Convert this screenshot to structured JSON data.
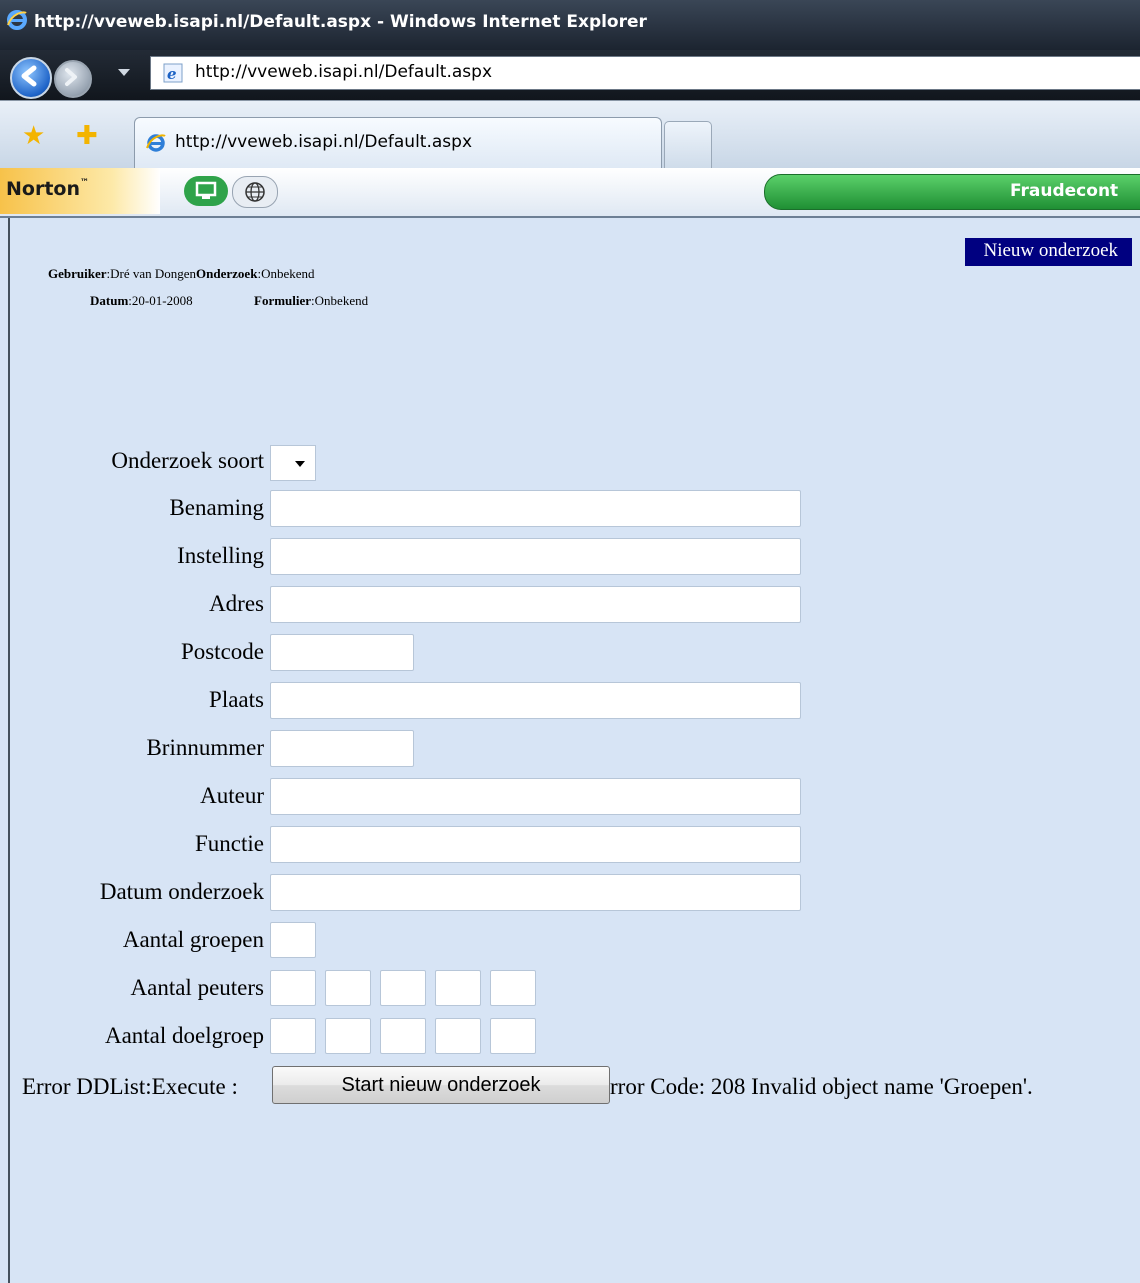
{
  "window": {
    "title": "http://vveweb.isapi.nl/Default.aspx - Windows Internet Explorer"
  },
  "address": {
    "url": "http://vveweb.isapi.nl/Default.aspx"
  },
  "tab": {
    "label": "http://vveweb.isapi.nl/Default.aspx"
  },
  "norton": {
    "brand": "Norton",
    "tm": "™",
    "fraud_label": "Fraudecont"
  },
  "page": {
    "new_investigation_label": "Nieuw onderzoek",
    "info": {
      "user_label": "Gebruiker",
      "user_value": "Dré van Dongen",
      "inv_label": "Onderzoek",
      "inv_value": "Onbekend",
      "date_label": "Datum",
      "date_value": "20-01-2008",
      "form_label": "Formulier",
      "form_value": "Onbekend"
    },
    "fields": {
      "onderzoek_soort": "Onderzoek soort",
      "benaming": "Benaming",
      "instelling": "Instelling",
      "adres": "Adres",
      "postcode": "Postcode",
      "plaats": "Plaats",
      "brinnummer": "Brinnummer",
      "auteur": "Auteur",
      "functie": "Functie",
      "datum_onderzoek": "Datum onderzoek",
      "aantal_groepen": "Aantal groepen",
      "aantal_peuters": "Aantal peuters",
      "aantal_doelgroep": "Aantal doelgroep"
    },
    "error_left": "Error DDList:Execute :",
    "error_right": "rror Code: 208 Invalid object name 'Groepen'.",
    "start_button": "Start nieuw onderzoek"
  },
  "icons": {
    "ie": "ie-logo-icon",
    "back": "back-arrow-icon",
    "forward": "forward-arrow-icon",
    "favorites": "favorites-star-icon",
    "add_favorites": "add-favorites-star-icon",
    "computer": "computer-icon",
    "globe": "globe-icon"
  }
}
